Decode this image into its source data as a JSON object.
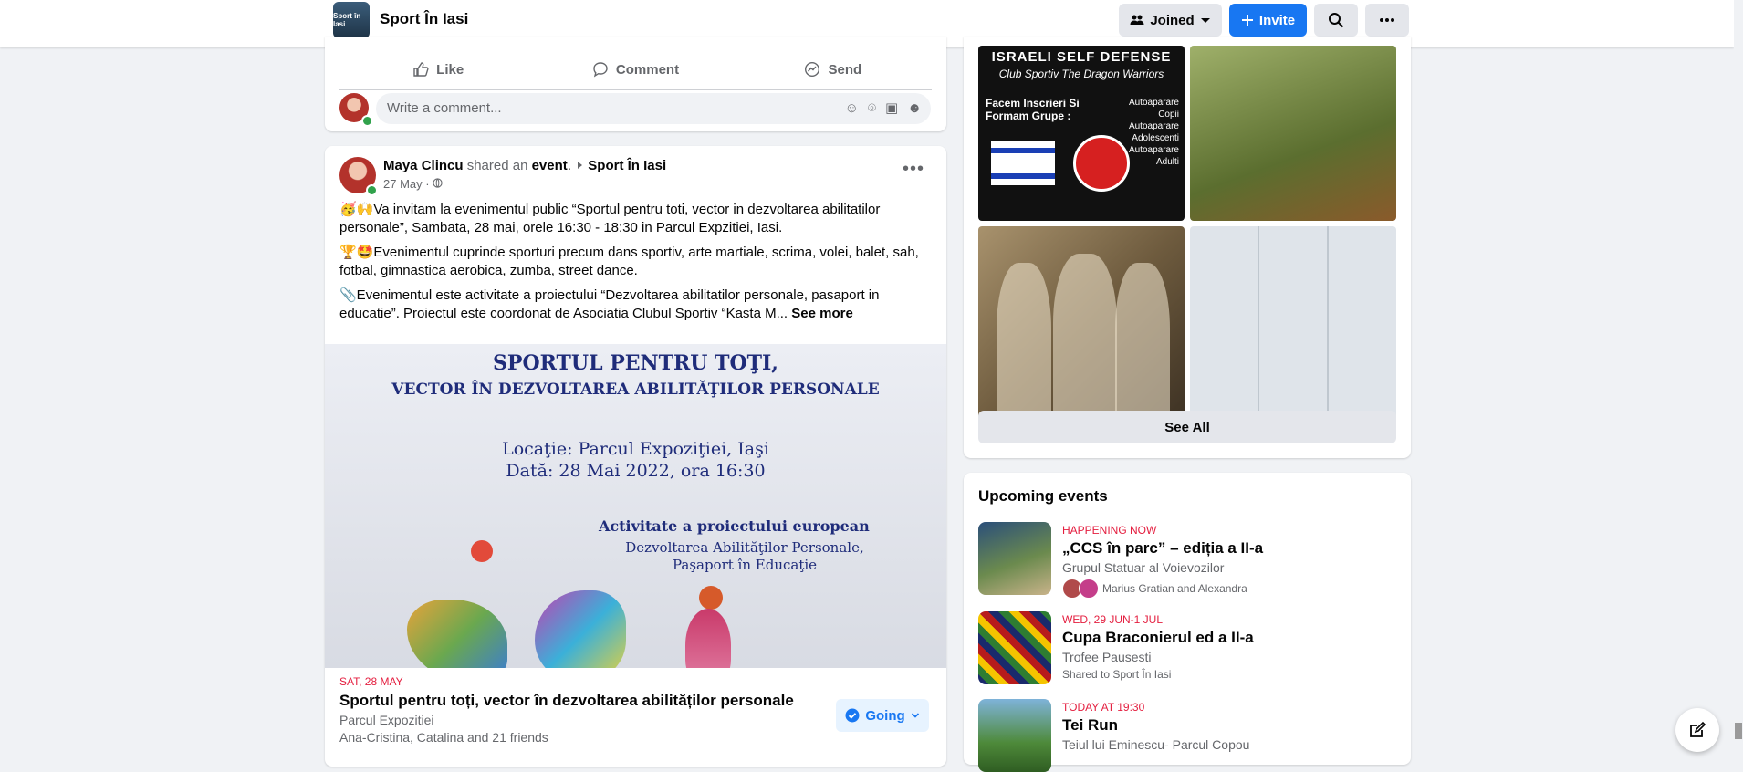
{
  "header": {
    "group_thumb_text": "Sport în Iasi",
    "group_name": "Sport În Iasi",
    "joined_label": "Joined",
    "invite_label": "Invite"
  },
  "prev_post": {
    "like_label": "Like",
    "comment_label": "Comment",
    "send_label": "Send",
    "comment_placeholder": "Write a comment..."
  },
  "post": {
    "author": "Maya Clincu",
    "shared_text": " shared an ",
    "shared_object": "event",
    "group": "Sport În Iasi",
    "date": "27 May ·",
    "para1": "🥳🙌Va invitam la evenimentul public “Sportul pentru toti, vector in dezvoltarea abilitatilor personale”, Sambata, 28 mai, orele 16:30 - 18:30 in Parcul Expzitiei, Iasi.",
    "para2": "🏆🤩Evenimentul cuprinde sporturi precum dans sportiv, arte martiale, scrima, volei, balet, sah, fotbal, gimnastica aerobica, zumba, street dance.",
    "para3": "📎Evenimentul este activitate a proiectului “Dezvoltarea abilitatilor personale, pasaport in educatie”. Proiectul este coordonat de Asociatia Clubul Sportiv “Kasta M...",
    "see_more": "See more",
    "poster": {
      "line1": "SPORTUL PENTRU TOŢI,",
      "line2": "VECTOR ÎN DEZVOLTAREA ABILITĂŢILOR PERSONALE",
      "line3": "Locaţie: Parcul Expoziţiei, Iaşi",
      "line4": "Dată: 28 Mai 2022, ora 16:30",
      "line5": "Activitate a proiectului european",
      "line6": "Dezvoltarea Abilităţilor Personale, Paşaport în Educaţie"
    },
    "event": {
      "date": "SAT, 28 MAY",
      "title": "Sportul pentru toți, vector în dezvoltarea abilităților personale",
      "location": "Parcul Expozitiei",
      "friends": "Ana-Cristina, Catalina and 21 friends",
      "going_label": "Going"
    }
  },
  "media": {
    "tile1_l1": "ISRAELI SELF DEFENSE",
    "tile1_l2": "Club Sportiv The Dragon Warriors",
    "tile1_l3": "Facem Inscrieri Si Formam Grupe :",
    "tile1_l4": "Autoaparare Copii Autoaparare Adolescenti Autoaparare Adulti",
    "see_all": "See All"
  },
  "upcoming": {
    "title": "Upcoming events",
    "events": [
      {
        "date": "HAPPENING NOW",
        "name": "„CCS în parc” – ediția a II-a",
        "org": "Grupul Statuar al Voievozilor",
        "sub": "Marius Gratian and Alexandra"
      },
      {
        "date": "WED, 29 JUN-1 JUL",
        "name": "Cupa Braconierul ed a II-a",
        "org": "Trofee Pausesti",
        "sub": "Shared to Sport În Iasi"
      },
      {
        "date": "TODAY AT 19:30",
        "name": "Tei Run",
        "org": "Teiul lui Eminescu- Parcul Copou",
        "sub": ""
      }
    ]
  }
}
